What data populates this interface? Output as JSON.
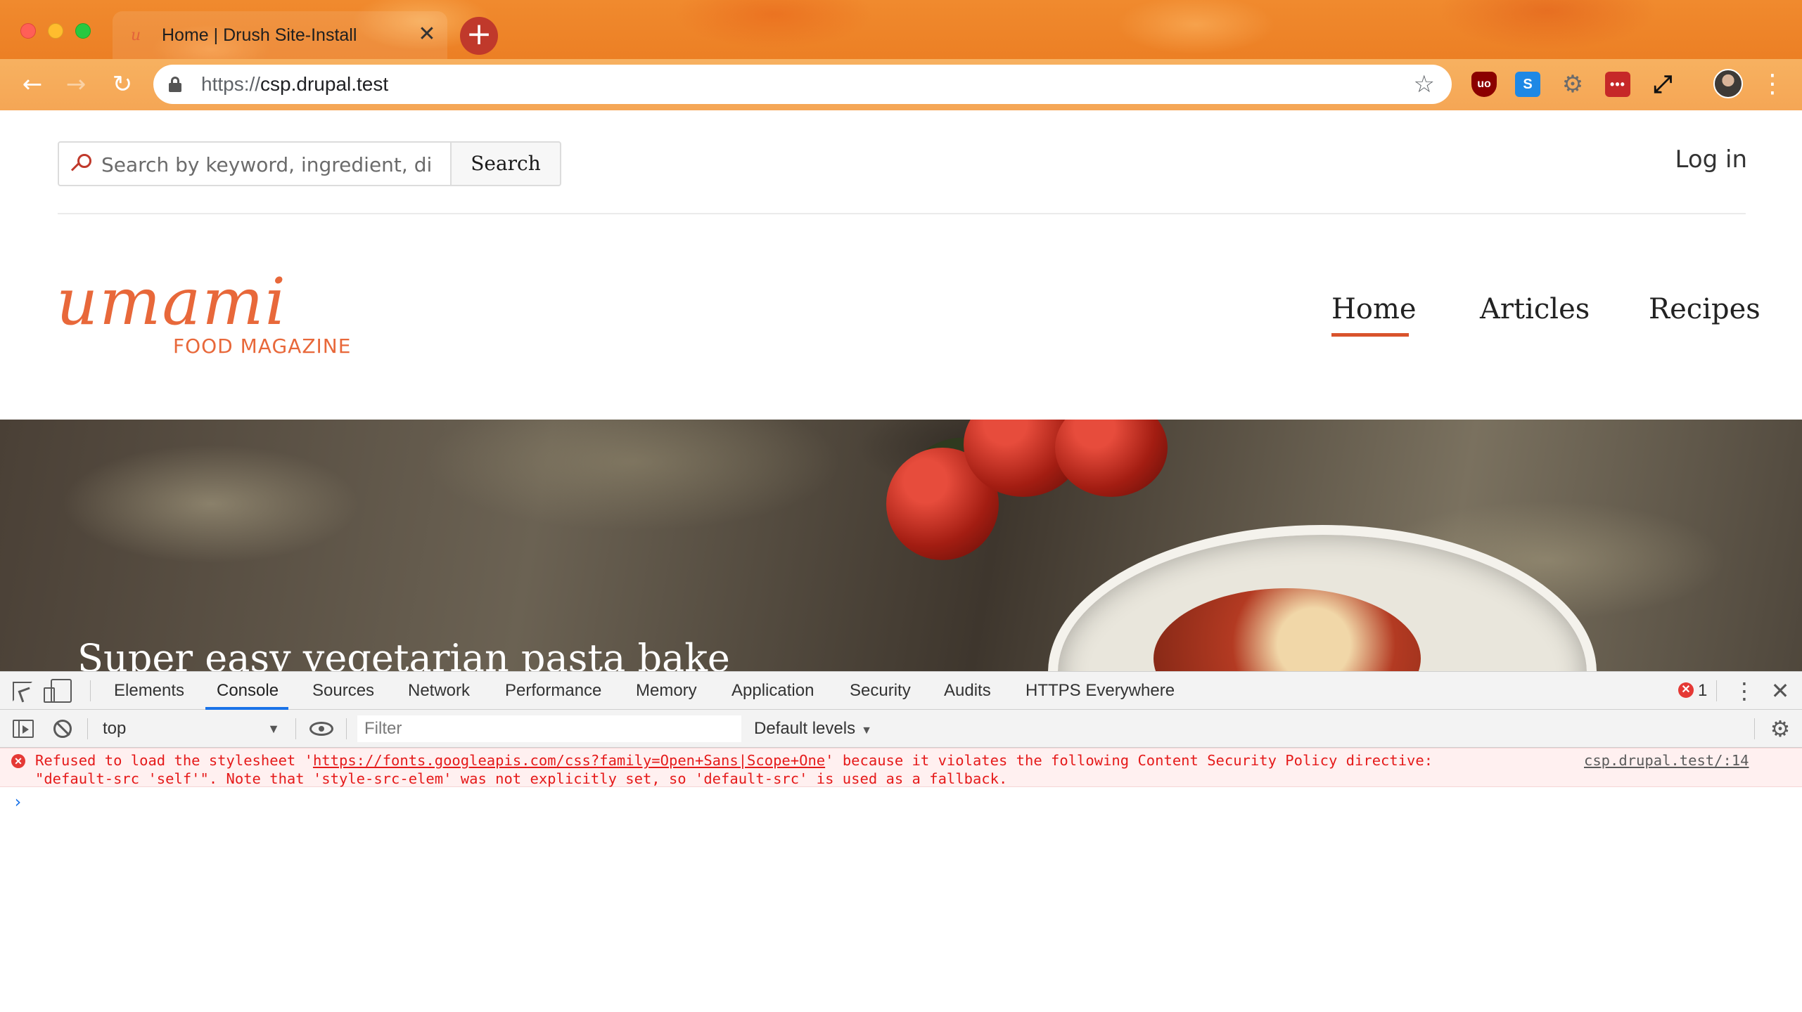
{
  "browser": {
    "tab_title": "Home | Drush Site-Install",
    "tab_close": "✕",
    "new_tab": "+",
    "url_scheme": "https://",
    "url_host": "csp.drupal.test",
    "back": "←",
    "forward": "→",
    "reload": "↻",
    "star": "☆",
    "menu": "⋮",
    "extensions": {
      "ublock": "uo",
      "s": "S",
      "gear": "⚙",
      "lastpass": "•••",
      "expand": "⤢"
    }
  },
  "site": {
    "search": {
      "placeholder": "Search by keyword, ingredient, di",
      "button": "Search"
    },
    "login": "Log in",
    "logo": {
      "mark": "umami",
      "subtitle": "FOOD MAGAZINE"
    },
    "nav": [
      {
        "label": "Home",
        "active": true
      },
      {
        "label": "Articles",
        "active": false
      },
      {
        "label": "Recipes",
        "active": false
      }
    ],
    "hero_caption": "Super easy vegetarian pasta bake"
  },
  "devtools": {
    "tabs": [
      "Elements",
      "Console",
      "Sources",
      "Network",
      "Performance",
      "Memory",
      "Application",
      "Security",
      "Audits",
      "HTTPS Everywhere"
    ],
    "active_tab": "Console",
    "error_count": "1",
    "kebab": "⋮",
    "close": "✕",
    "context": "top",
    "context_caret": "▼",
    "filter_placeholder": "Filter",
    "levels": "Default levels",
    "levels_caret": "▼",
    "settings": "⚙",
    "messages": [
      {
        "level": "error",
        "prefix": "Refused to load the stylesheet '",
        "link": "https://fonts.googleapis.com/css?family=Open+Sans|Scope+One",
        "suffix": "' because it violates the following Content Security Policy directive:",
        "line2": "\"default-src 'self'\". Note that 'style-src-elem' was not explicitly set, so 'default-src' is used as a fallback.",
        "source": "csp.drupal.test/:14"
      }
    ],
    "prompt": "›"
  },
  "colors": {
    "brand_orange": "#e8683a",
    "nav_active": "#d9532c",
    "error_red": "#e51a1a",
    "devtools_accent": "#1a73e8"
  }
}
